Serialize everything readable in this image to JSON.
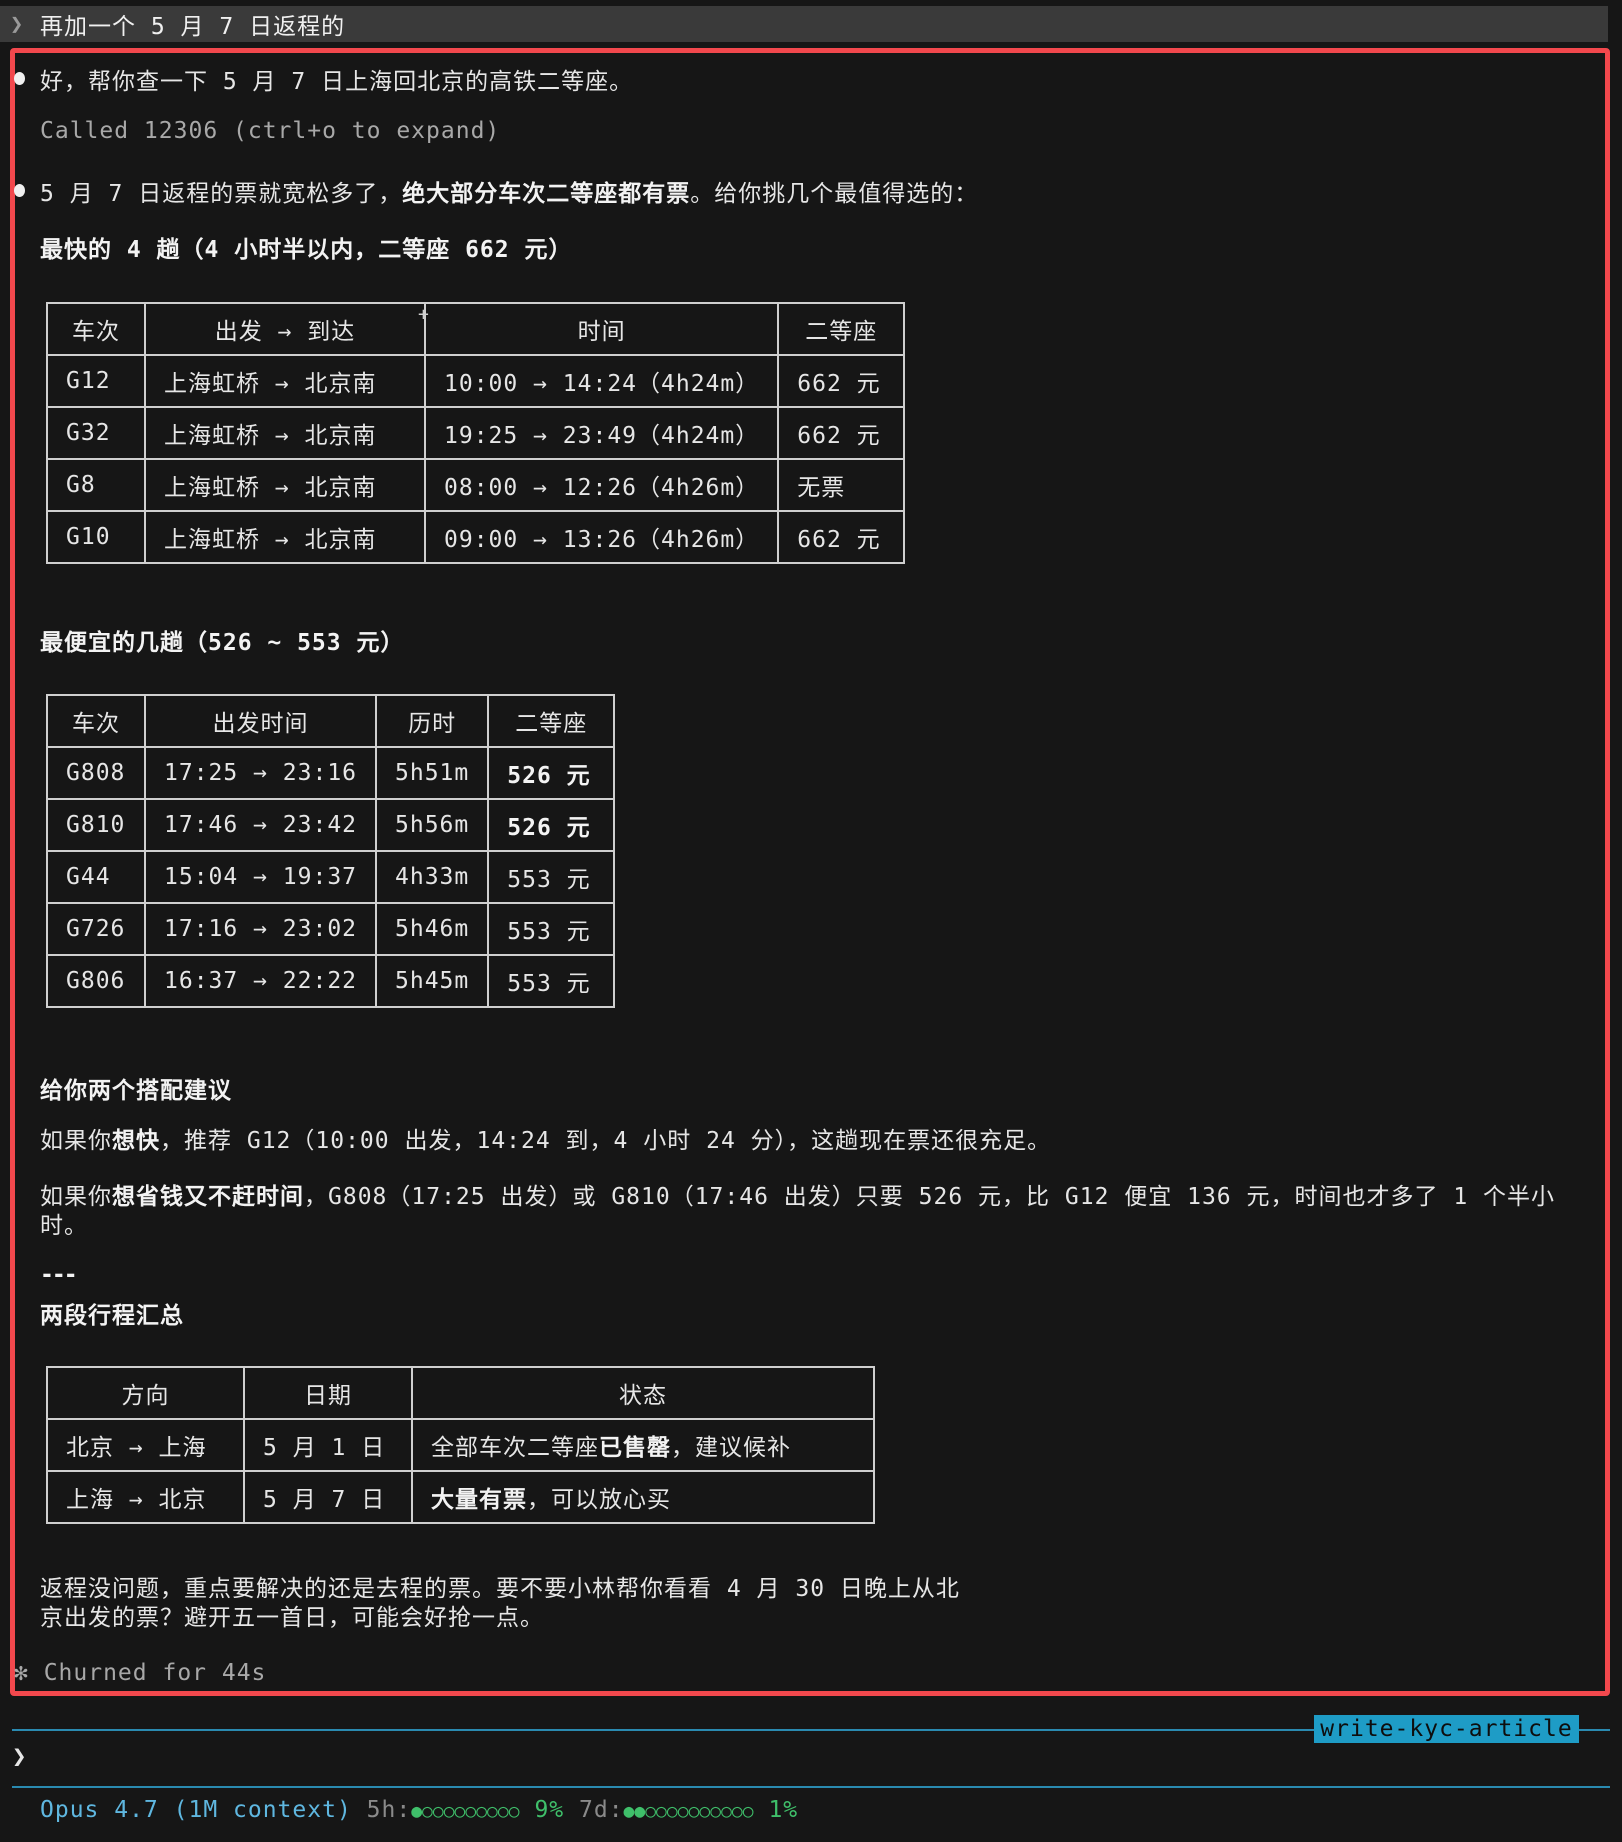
{
  "prompt": {
    "chevron": "❯",
    "text": "再加一个 5 月 7 日返程的"
  },
  "messages": {
    "intro": "好，帮你查一下 5 月 7 日上海回北京的高铁二等座。",
    "tool_call": "Called 12306 (ctrl+o to expand)",
    "summary_a": "5 月 7 日返程的票就宽松多了，",
    "summary_b": "绝大部分车次二等座都有票",
    "summary_c": "。给你挑几个最值得选的："
  },
  "fastest": {
    "heading": "最快的 4 趟（4 小时半以内，二等座 662 元）",
    "headers": [
      "车次",
      "出发 → 到达",
      "时间",
      "二等座"
    ],
    "rows": [
      [
        "G12",
        "上海虹桥 → 北京南",
        "10:00 → 14:24（4h24m）",
        "662 元"
      ],
      [
        "G32",
        "上海虹桥 → 北京南",
        "19:25 → 23:49（4h24m）",
        "662 元"
      ],
      [
        "G8",
        "上海虹桥 → 北京南",
        "08:00 → 12:26（4h26m）",
        "无票"
      ],
      [
        "G10",
        "上海虹桥 → 北京南",
        "09:00 → 13:26（4h26m）",
        "662 元"
      ]
    ]
  },
  "cheapest": {
    "heading": "最便宜的几趟（526 ~ 553 元）",
    "headers": [
      "车次",
      "出发时间",
      "历时",
      "二等座"
    ],
    "rows": [
      [
        "G808",
        "17:25 → 23:16",
        "5h51m",
        "526 元"
      ],
      [
        "G810",
        "17:46 → 23:42",
        "5h56m",
        "526 元"
      ],
      [
        "G44",
        "15:04 → 19:37",
        "4h33m",
        "553 元"
      ],
      [
        "G726",
        "17:16 → 23:02",
        "5h46m",
        "553 元"
      ],
      [
        "G806",
        "16:37 → 22:22",
        "5h45m",
        "553 元"
      ]
    ]
  },
  "advice": {
    "heading": "给你两个搭配建议",
    "p1_a": "如果你",
    "p1_b": "想快",
    "p1_c": "，推荐 G12（10:00 出发，14:24 到，4 小时 24 分），这趟现在票还很充足。",
    "p2_a": "如果你",
    "p2_b": "想省钱又不赶时间",
    "p2_c": "，G808（17:25 出发）或 G810（17:46 出发）只要 526 元，比 G12 便宜 136 元，时间也才多了 1 个半小时。"
  },
  "divider": "---",
  "summary": {
    "heading": "两段行程汇总",
    "headers": [
      "方向",
      "日期",
      "状态"
    ],
    "rows": [
      {
        "dir": "北京 → 上海",
        "date": "5 月 1 日",
        "status_a": "全部车次二等座",
        "status_b": "已售罄",
        "status_c": "，建议候补"
      },
      {
        "dir": "上海 → 北京",
        "date": "5 月 7 日",
        "status_a": "",
        "status_b": "大量有票",
        "status_c": "，可以放心买"
      }
    ]
  },
  "closing": "返程没问题，重点要解决的还是去程的票。要不要小林帮你看看 4 月 30 日晚上从北京出发的票？避开五一首日，可能会好抢一点。",
  "churned": "✻ Churned for 44s",
  "session_tag": "write-kyc-article",
  "input_chevron": "❯",
  "status_bar": {
    "model": "Opus 4.7 (1M context)",
    "five_h_label": "5h:",
    "five_h_dots": "●○○○○○○○○○",
    "five_h_pct": "9%",
    "seven_d_label": "7d:",
    "seven_d_dots": "●●○○○○○○○○○○",
    "seven_d_pct": "1%"
  },
  "colors": {
    "background": "#161616",
    "highlight_border": "#f2484d",
    "accent": "#1e9cc6",
    "status_green": "#3fbf6a"
  }
}
